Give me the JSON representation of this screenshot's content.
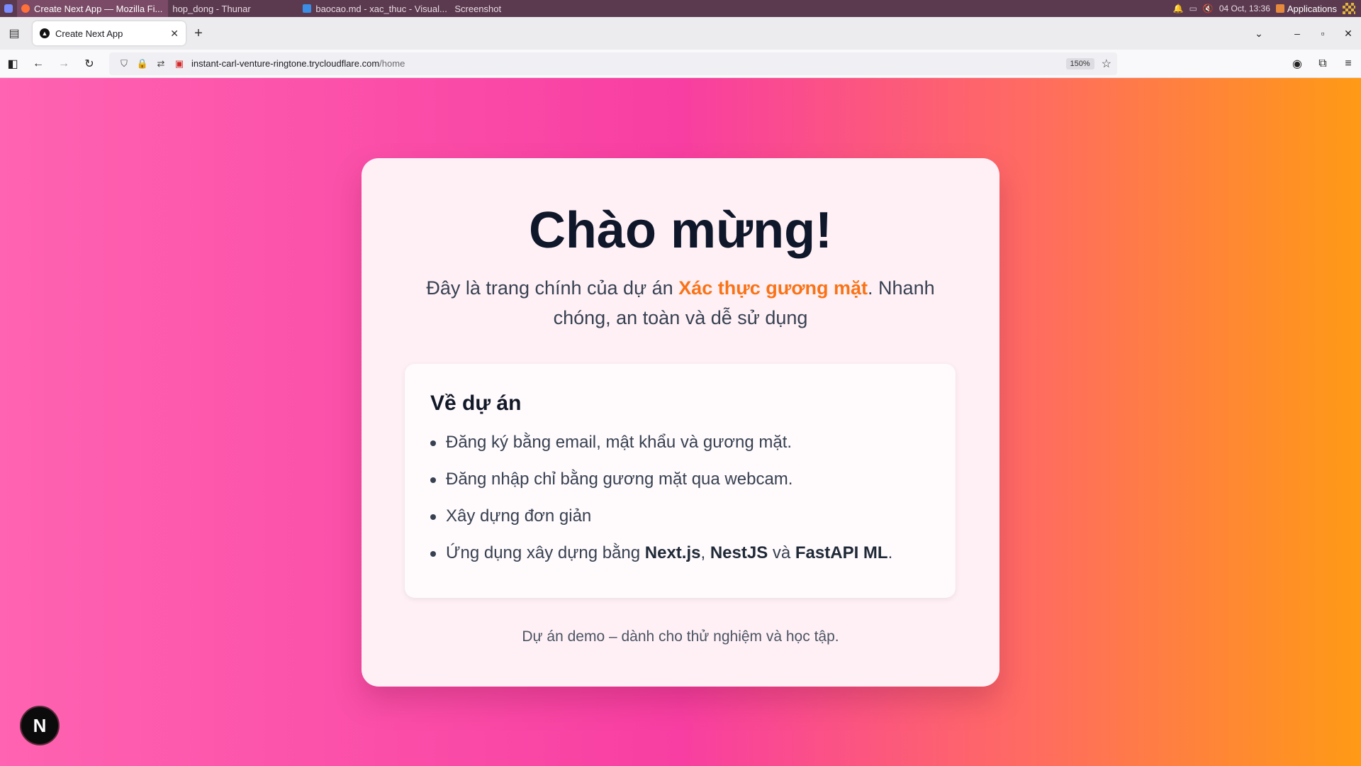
{
  "taskbar": {
    "tasks": [
      {
        "label": "Create Next App — Mozilla Fi...",
        "icon": "firefox-icon"
      },
      {
        "label": "hop_dong - Thunar",
        "icon": "folder-icon"
      },
      {
        "label": "baocao.md - xac_thuc - Visual...",
        "icon": "vscode-icon"
      },
      {
        "label": "Screenshot",
        "icon": "screenshot-icon"
      }
    ],
    "clock": "04 Oct, 13:36",
    "applications_label": "Applications"
  },
  "browser": {
    "tab_title": "Create Next App",
    "url_host": "instant-carl-venture-ringtone.trycloudflare.com",
    "url_path": "/home",
    "zoom": "150%"
  },
  "page": {
    "heading": "Chào mừng!",
    "subtitle_before": "Đây là trang chính của dự án ",
    "subtitle_highlight": "Xác thực gương mặt",
    "subtitle_after": ". Nhanh chóng, an toàn và dễ sử dụng",
    "about_title": "Về dự án",
    "about_items": [
      "Đăng ký bằng email, mật khẩu và gương mặt.",
      "Đăng nhập chỉ bằng gương mặt qua webcam.",
      "Xây dựng đơn giản"
    ],
    "tech_prefix": "Ứng dụng xây dựng bằng ",
    "tech_1": "Next.js",
    "tech_sep": ", ",
    "tech_2": "NestJS",
    "tech_and": " và ",
    "tech_3": "FastAPI ML",
    "tech_suffix": ".",
    "footer_note": "Dự án demo – dành cho thử nghiệm và học tập."
  },
  "next_badge": "N",
  "colors": {
    "highlight": "#f97316",
    "gradient_start": "#ff63b1",
    "gradient_end": "#ff9a15",
    "heading": "#0f172a"
  }
}
